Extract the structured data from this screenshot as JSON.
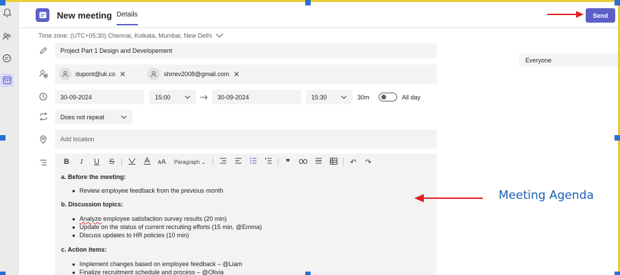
{
  "header": {
    "title": "New meeting",
    "tab_details": "Details",
    "send_label": "Send"
  },
  "timezone": {
    "label": "Time zone: (UTC+05:30) Chennai, Kolkata, Mumbai, New Delhi"
  },
  "form": {
    "title_value": "Project Part 1 Design and Developement",
    "attendees": [
      {
        "email": "dupont@uk.co"
      },
      {
        "email": "shrrev2008@gmail.com"
      }
    ],
    "start_date": "30-09-2024",
    "start_time": "15:00",
    "end_date": "30-09-2024",
    "end_time": "15:30",
    "duration": "30m",
    "all_day_label": "All day",
    "all_day_on": false,
    "repeat_value": "Does not repeat",
    "location_placeholder": "Add location"
  },
  "right_panel": {
    "everyone_label": "Everyone"
  },
  "editor": {
    "paragraph_style": "Paragraph",
    "sections": [
      {
        "heading": "a. Before the meeting:",
        "items": [
          "Review employee feedback from the previous month"
        ]
      },
      {
        "heading": "b. Discussion topics:",
        "items": [
          "Analyze employee satisfaction survey results (20 min)",
          "Update on the status of current recruiting efforts (15 min, @Emma)",
          "Discuss updates to HR policies (10 min)"
        ]
      },
      {
        "heading": "c. Action items:",
        "items": [
          "Implement changes based on employee feedback – @Liam",
          "Finalize recruitment schedule and process – @Olivia"
        ]
      }
    ]
  },
  "annotations": {
    "agenda_label": "Meeting Agenda",
    "arrow_color": "#e02020",
    "label_color": "#1f5fb6"
  },
  "colors": {
    "accent": "#5b5fc7",
    "field_bg": "#f3f3f3"
  }
}
